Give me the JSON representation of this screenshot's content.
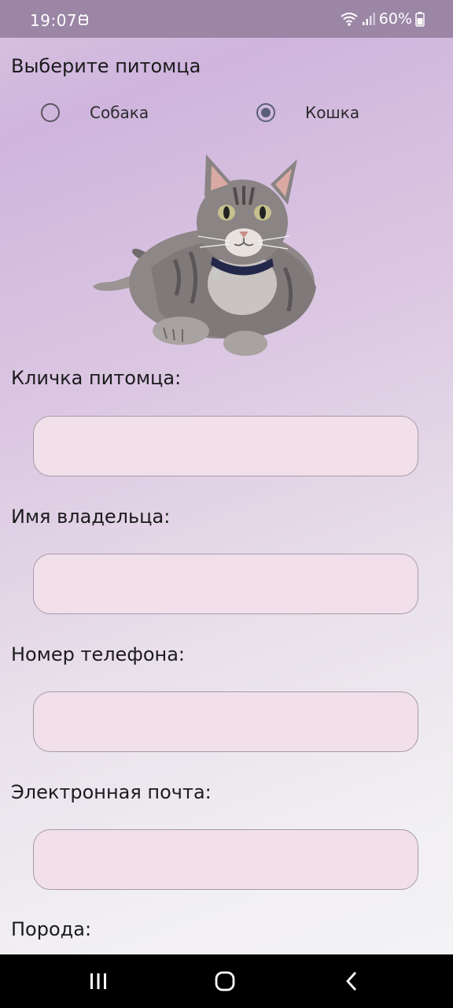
{
  "status_bar": {
    "time": "19:07",
    "battery": "60%",
    "icons": [
      "app-notification-icon",
      "wifi-icon",
      "signal-icon",
      "battery-icon"
    ]
  },
  "form": {
    "pet_choice_title": "Выберите питомца",
    "options": [
      {
        "label": "Собака",
        "selected": false
      },
      {
        "label": "Кошка",
        "selected": true
      }
    ],
    "fields": [
      {
        "label": "Кличка питомца:",
        "value": ""
      },
      {
        "label": "Имя владельца:",
        "value": ""
      },
      {
        "label": "Номер телефона:",
        "value": ""
      },
      {
        "label": "Электронная почта:",
        "value": ""
      }
    ],
    "breed_label": "Порода:"
  },
  "pet_image": {
    "subject": "cat"
  },
  "nav_bar": {
    "icons": [
      "recent-apps-icon",
      "home-icon",
      "back-icon"
    ]
  },
  "colors": {
    "status_bar": "#9b86a6",
    "field_fill": "#f1e0ea",
    "field_border": "#a79aa7",
    "radio_accent": "#5a5f78"
  }
}
